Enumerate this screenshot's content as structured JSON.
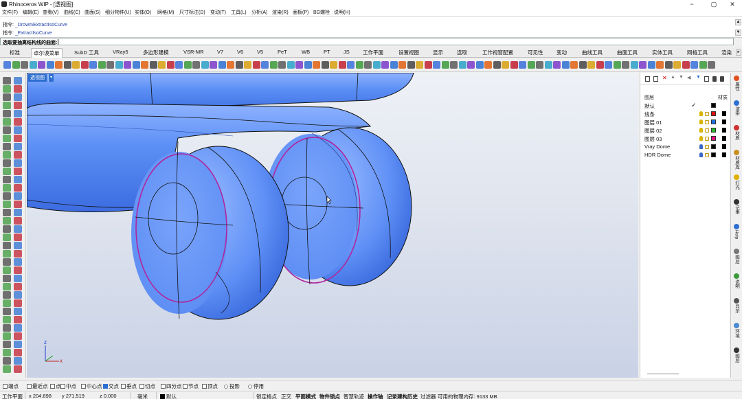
{
  "window": {
    "title": "Rhinoceros WIP - [透视图]",
    "minimize": "−",
    "maximize": "▢",
    "close": "✕"
  },
  "menu": [
    "文件(F)",
    "编辑(E)",
    "查看(V)",
    "曲线(C)",
    "曲面(S)",
    "细分物件(U)",
    "实体(O)",
    "网格(M)",
    "尺寸标注(D)",
    "变动(T)",
    "工具(L)",
    "分析(A)",
    "渲染(R)",
    "面板(P)",
    "BG螺栓",
    "说明(H)"
  ],
  "command": {
    "history": [
      {
        "label": "指令:",
        "value": "_DrowmExtractIsoCurve"
      },
      {
        "label": "指令:",
        "value": "_ExtractIsoCurve"
      }
    ],
    "prompt": "选取要抽离结构线的曲面:"
  },
  "tabs": [
    "标准",
    "卓尔谟菜单",
    "SubD 工具",
    "VRay5",
    "多边形建模",
    "VSR-MR",
    "V7",
    "V6",
    "V5",
    "PeT",
    "WB",
    "PT",
    "JS",
    "工作平面",
    "设置视图",
    "显示",
    "选取",
    "工作视窗配置",
    "可见性",
    "变动",
    "曲线工具",
    "曲面工具",
    "实体工具",
    "网格工具",
    "渲染"
  ],
  "toolbar_icons": [
    "gear-icon",
    "sphere-icon",
    "render-icon",
    "material-icon",
    "grid-icon",
    "camera-icon",
    "texture-icon",
    "color-icon",
    "light-icon",
    "wireframe-icon"
  ],
  "viewport": {
    "label": "透视图",
    "dropdown": "▾",
    "axis_z": "z",
    "axis_x": "x",
    "axis_y": "y",
    "colors": {
      "body": "#5b8ff5",
      "body_dark": "#3d6fe0",
      "highlight": "#a9c6ff",
      "isocurve": "#b0259c",
      "edge": "#111111"
    }
  },
  "layer_panel": {
    "header_layer": "图层",
    "header_material": "材质",
    "layers": [
      {
        "name": "默认",
        "current": "✓",
        "color": "#000000",
        "bulb": "#d9b300"
      },
      {
        "name": "线条",
        "color": "#e01010",
        "bulb": "#d9b300"
      },
      {
        "name": "图层 01",
        "color": "#1f6fe0",
        "bulb": "#d9b300"
      },
      {
        "name": "图层 02",
        "color": "#27b427",
        "bulb": "#d9b300"
      },
      {
        "name": "图层 03",
        "color": "#e0107a",
        "bulb": "#d9b300"
      },
      {
        "name": "Vray Dome",
        "color": "#000000",
        "bulb": "#3a68c8"
      },
      {
        "name": "HDR Dome",
        "color": "#000000",
        "bulb": "#3a68c8"
      }
    ]
  },
  "right_tabs": [
    {
      "label": "属性",
      "color": "#e05020"
    },
    {
      "label": "渲染",
      "color": "#2d6fd1"
    },
    {
      "label": "材质",
      "color": "#d03030"
    },
    {
      "label": "材质库",
      "color": "#c99020"
    },
    {
      "label": "灯光",
      "color": "#e0b000"
    },
    {
      "label": "记事",
      "color": "#333333"
    },
    {
      "label": "Help",
      "color": "#2d6fd1"
    },
    {
      "label": "图层",
      "color": "#777777"
    },
    {
      "label": "说明",
      "color": "#3a9a3a"
    },
    {
      "label": "显示",
      "color": "#555555"
    },
    {
      "label": "环境",
      "color": "#4a8ad0"
    },
    {
      "label": "图层",
      "color": "#333333"
    }
  ],
  "osnap": [
    {
      "label": "端点",
      "checked": false
    },
    {
      "label": "最近点",
      "checked": false
    },
    {
      "label": "点",
      "checked": false
    },
    {
      "label": "中点",
      "checked": false
    },
    {
      "label": "中心点",
      "checked": false
    },
    {
      "label": "交点",
      "checked": true
    },
    {
      "label": "垂点",
      "checked": false
    },
    {
      "label": "切点",
      "checked": false
    },
    {
      "label": "四分点",
      "checked": false
    },
    {
      "label": "节点",
      "checked": false
    },
    {
      "label": "顶点",
      "checked": false
    }
  ],
  "osnap_radios": [
    "投影",
    "停用"
  ],
  "status": {
    "cplane": "工作平面",
    "x": "x 204.898",
    "y": "y 271.519",
    "z": "z 0.000",
    "unit": "毫米",
    "layer": "默认",
    "toggles": [
      "锁定格点",
      "正交",
      "平面模式",
      "物件锁点",
      "智慧轨迹",
      "操作轴",
      "记录建构历史",
      "过滤器"
    ],
    "memory": "可用的物理内存: 9133 MB"
  }
}
